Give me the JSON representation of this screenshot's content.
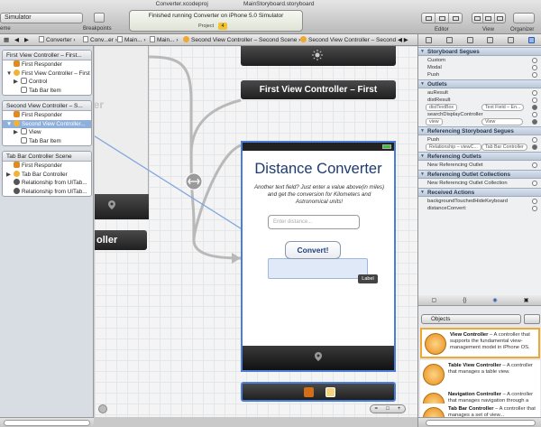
{
  "toolbar": {
    "scheme": "Simulator",
    "scheme_label": "eme",
    "breakpoints_label": "Breakpoints",
    "doc_tabs": [
      "Converter.xcodeproj",
      "MainStoryboard.storyboard"
    ],
    "activity_message": "Finished running Converter on iPhone 5.0 Simulator",
    "activity_project": "Project",
    "warning_count": "4",
    "editor_label": "Editor",
    "view_label": "View",
    "organizer_label": "Organizer"
  },
  "jumpbar": {
    "items": [
      "Converter",
      "Conv...er",
      "Main...",
      "Main...",
      "Second View Controller – Second Scene",
      "Second View Controller – Second"
    ]
  },
  "outline": {
    "scenes": [
      {
        "title": "First View Controller – First...",
        "rows": [
          {
            "label": "First Responder",
            "icon": "cube",
            "disc": ""
          },
          {
            "label": "First View Controller – First",
            "icon": "vc",
            "disc": "▼"
          },
          {
            "label": "Control",
            "icon": "box",
            "disc": "▶"
          },
          {
            "label": "Tab Bar Item",
            "icon": "box",
            "disc": ""
          }
        ]
      },
      {
        "title": "Second View Controller – S...",
        "rows": [
          {
            "label": "First Responder",
            "icon": "cube",
            "disc": ""
          },
          {
            "label": "Second View Controller...",
            "icon": "vc",
            "disc": "▼",
            "selected": true
          },
          {
            "label": "View",
            "icon": "box",
            "disc": "▶"
          },
          {
            "label": "Tab Bar Item",
            "icon": "box",
            "disc": ""
          }
        ]
      },
      {
        "title": "Tab Bar Controller Scene",
        "rows": [
          {
            "label": "First Responder",
            "icon": "cube",
            "disc": ""
          },
          {
            "label": "Tab Bar Controller",
            "icon": "vc",
            "disc": "▶"
          },
          {
            "label": "Relationship from UITab...",
            "icon": "rel",
            "disc": ""
          },
          {
            "label": "Relationship from UITab...",
            "icon": "rel",
            "disc": ""
          }
        ]
      }
    ]
  },
  "canvas": {
    "first_vc_ghost_title": "ller",
    "tabbar_ghost_label": "oller",
    "first_vc_label": "First View Controller – First",
    "second_vc": {
      "title": "Distance Converter",
      "description": "Another text field? Just enter a value above(in miles) and get the conversion for Kilometers and Astronomical units!",
      "field_placeholder": "Enter distance...",
      "button_label": "Convert!",
      "label_tag": "Label"
    }
  },
  "inspector": {
    "sections": [
      {
        "title": "Storyboard Segues",
        "rows": [
          "Custom",
          "Modal",
          "Push"
        ]
      },
      {
        "title": "Outlets",
        "rows": [
          "auResult",
          "distResult",
          "distTextBox",
          "searchDisplayController",
          "view"
        ]
      },
      {
        "title": "Referencing Storyboard Segues",
        "rows": [
          "Push",
          "Relationship – viewC..."
        ]
      },
      {
        "title": "Referencing Outlets",
        "rows": [
          "New Referencing Outlet"
        ]
      },
      {
        "title": "Referencing Outlet Collections",
        "rows": [
          "New Referencing Outlet Collection"
        ]
      },
      {
        "title": "Received Actions",
        "rows": [
          "backgroundTouchedHideKeyboard",
          "distanceConvert:"
        ]
      }
    ],
    "chips": {
      "distTextBox": "Text Field – En...",
      "view": "View",
      "relationship": "Tab Bar Controller"
    }
  },
  "library": {
    "selected": "Objects",
    "items": [
      {
        "name": "View Controller",
        "desc": " – A controller that supports the fundamental view-management model in iPhone OS."
      },
      {
        "name": "Table View Controller",
        "desc": " – A controller that manages a table view."
      },
      {
        "name": "Navigation Controller",
        "desc": " – A controller that manages navigation through a hierarchy of views."
      },
      {
        "name": "Tab Bar Controller",
        "desc": " – A controller that manages a set of view..."
      }
    ]
  }
}
